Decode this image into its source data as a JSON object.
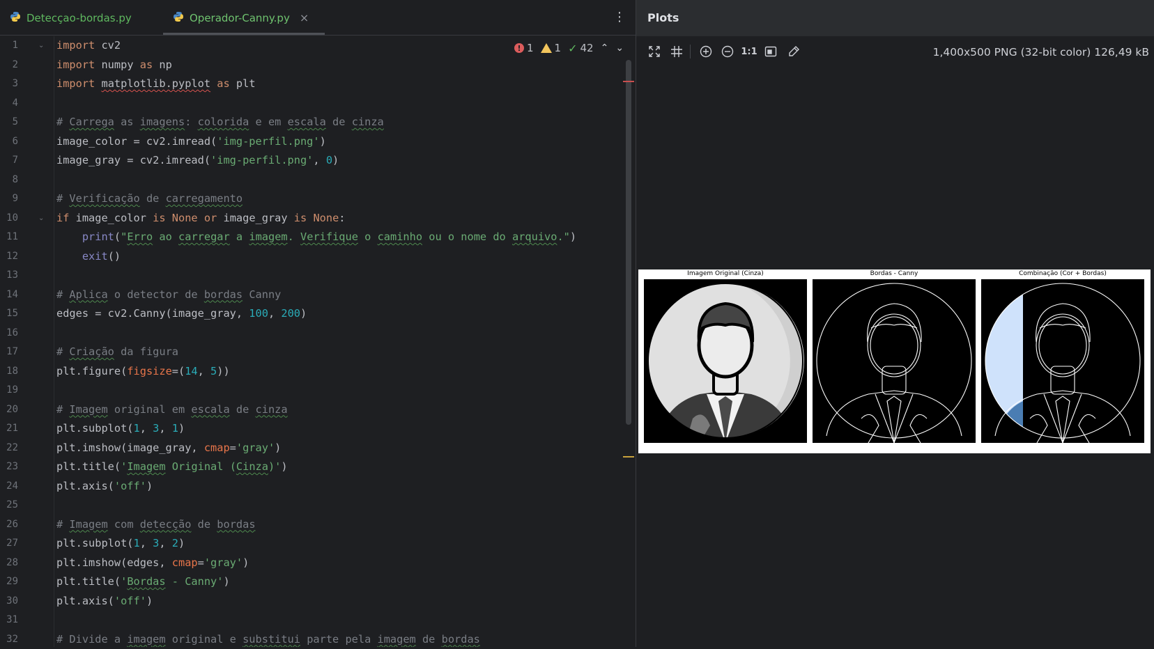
{
  "tabs": [
    {
      "label": "Detecçao-bordas.py",
      "icon": "python-icon"
    },
    {
      "label": "Operador-Canny.py",
      "icon": "python-icon",
      "close": "×"
    }
  ],
  "tabs_menu": "⋮",
  "inspections": {
    "errors": "1",
    "warnings": "1",
    "ok": "42"
  },
  "plots": {
    "title": "Plots",
    "image_info": "1,400x500 PNG (32-bit color) 126,49 kB",
    "toolbar": [
      "fit-icon",
      "grid-icon",
      "zoom-in-icon",
      "zoom-out-icon",
      "actual-size-icon",
      "background-icon",
      "color-picker-icon"
    ],
    "actual_size_label": "1:1",
    "subplot_titles": [
      "Imagem Original (Cinza)",
      "Bordas - Canny",
      "Combinação (Cor + Bordas)"
    ]
  },
  "line_numbers": [
    "1",
    "2",
    "3",
    "4",
    "5",
    "6",
    "7",
    "8",
    "9",
    "10",
    "11",
    "12",
    "13",
    "14",
    "15",
    "16",
    "17",
    "18",
    "19",
    "20",
    "21",
    "22",
    "23",
    "24",
    "25",
    "26",
    "27",
    "28",
    "29",
    "30",
    "31",
    "32"
  ],
  "code": {
    "l1a": "import",
    "l1b": " cv2",
    "l2a": "import",
    "l2b": " numpy ",
    "l2c": "as",
    "l2d": " np",
    "l3a": "import",
    "l3b": " ",
    "l3c": "matplotlib.pyplot",
    "l3d": " ",
    "l3e": "as",
    "l3f": " plt",
    "l5": [
      "# ",
      "Carrega",
      " as ",
      "imagens",
      ": ",
      "colorida",
      " e em ",
      "escala",
      " de ",
      "cinza"
    ],
    "l6a": "image_color = cv2.imread(",
    "l6b": "'img-perfil.png'",
    "l6c": ")",
    "l7a": "image_gray = cv2.imread(",
    "l7b": "'img-perfil.png'",
    "l7c": ", ",
    "l7d": "0",
    "l7e": ")",
    "l9": [
      "# ",
      "Verificação",
      " de ",
      "carregamento"
    ],
    "l10": [
      "if",
      " image_color ",
      "is",
      " ",
      "None",
      " ",
      "or",
      " image_gray ",
      "is",
      " ",
      "None",
      ":"
    ],
    "l11": [
      "    ",
      "print",
      "(",
      "\"",
      "Erro",
      " ao ",
      "carregar",
      " a ",
      "imagem",
      ". ",
      "Verifique",
      " o ",
      "caminho",
      " ou o nome do ",
      "arquivo",
      ".\"",
      ")"
    ],
    "l12": [
      "    ",
      "exit",
      "()"
    ],
    "l14": [
      "# ",
      "Aplica",
      " o detector de ",
      "bordas",
      " Canny"
    ],
    "l15": [
      "edges = cv2.Canny(image_gray, ",
      "100",
      ", ",
      "200",
      ")"
    ],
    "l17": [
      "# ",
      "Criação",
      " da figura"
    ],
    "l18": [
      "plt.figure(",
      "figsize",
      "=(",
      "14",
      ", ",
      "5",
      "))"
    ],
    "l20": [
      "# ",
      "Imagem",
      " original em ",
      "escala",
      " de ",
      "cinza"
    ],
    "l21": [
      "plt.subplot(",
      "1",
      ", ",
      "3",
      ", ",
      "1",
      ")"
    ],
    "l22": [
      "plt.imshow(image_gray, ",
      "cmap",
      "=",
      "'gray'",
      ")"
    ],
    "l23": [
      "plt.title(",
      "'",
      "Imagem",
      " Original (",
      "Cinza",
      ")'",
      ")"
    ],
    "l24": [
      "plt.axis(",
      "'off'",
      ")"
    ],
    "l26": [
      "# ",
      "Imagem",
      " com ",
      "detecção",
      " de ",
      "bordas"
    ],
    "l27": [
      "plt.subplot(",
      "1",
      ", ",
      "3",
      ", ",
      "2",
      ")"
    ],
    "l28": [
      "plt.imshow(edges, ",
      "cmap",
      "=",
      "'gray'",
      ")"
    ],
    "l29": [
      "plt.title(",
      "'",
      "Bordas",
      " - Canny'",
      ")"
    ],
    "l30": [
      "plt.axis(",
      "'off'",
      ")"
    ],
    "l32": [
      "# Divide a ",
      "imagem",
      " original e ",
      "substitui",
      " parte pela ",
      "imagem",
      " de ",
      "bordas"
    ]
  }
}
